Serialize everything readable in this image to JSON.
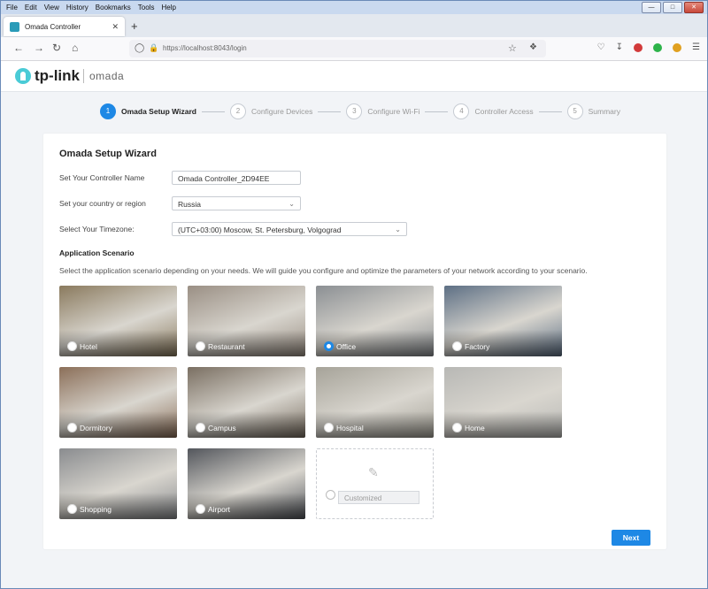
{
  "browser": {
    "menu": [
      "File",
      "Edit",
      "View",
      "History",
      "Bookmarks",
      "Tools",
      "Help"
    ],
    "tab_title": "Omada Controller",
    "url": "https://localhost:8043/login"
  },
  "brand": {
    "logo": "tp-link",
    "product": "omada"
  },
  "steps": [
    {
      "num": "1",
      "label": "Omada Setup Wizard",
      "active": true
    },
    {
      "num": "2",
      "label": "Configure Devices",
      "active": false
    },
    {
      "num": "3",
      "label": "Configure Wi-Fi",
      "active": false
    },
    {
      "num": "4",
      "label": "Controller Access",
      "active": false
    },
    {
      "num": "5",
      "label": "Summary",
      "active": false
    }
  ],
  "form": {
    "title": "Omada Setup Wizard",
    "controller_name_label": "Set Your Controller Name",
    "controller_name_value": "Omada Controller_2D94EE",
    "country_label": "Set your country or region",
    "country_value": "Russia",
    "timezone_label": "Select Your Timezone:",
    "timezone_value": "(UTC+03:00) Moscow, St. Petersburg, Volgograd",
    "scenario_heading": "Application Scenario",
    "scenario_desc": "Select the application scenario depending on your needs. We will guide you configure and optimize the parameters of your network according to your scenario.",
    "next_label": "Next"
  },
  "scenarios": [
    {
      "name": "Hotel",
      "selected": false,
      "color": "#8a7a5e"
    },
    {
      "name": "Restaurant",
      "selected": false,
      "color": "#9a8f84"
    },
    {
      "name": "Office",
      "selected": true,
      "color": "#8b8f93"
    },
    {
      "name": "Factory",
      "selected": false,
      "color": "#5d6f84"
    },
    {
      "name": "Dormitory",
      "selected": false,
      "color": "#8b6f59"
    },
    {
      "name": "Campus",
      "selected": false,
      "color": "#7a6f62"
    },
    {
      "name": "Hospital",
      "selected": false,
      "color": "#a6a399"
    },
    {
      "name": "Home",
      "selected": false,
      "color": "#b8b8b5"
    },
    {
      "name": "Shopping",
      "selected": false,
      "color": "#8a8c8f"
    },
    {
      "name": "Airport",
      "selected": false,
      "color": "#53565c"
    }
  ],
  "custom": {
    "placeholder": "Customized",
    "icon": "pencil-ruler-icon"
  },
  "colors": {
    "accent": "#1e88e5"
  }
}
